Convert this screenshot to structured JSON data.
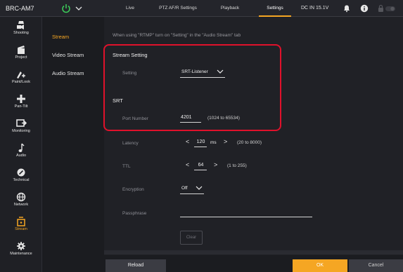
{
  "header": {
    "model": "BRC-AM7",
    "tabs": [
      {
        "label": "Live"
      },
      {
        "label": "PTZ AF/R Settings"
      },
      {
        "label": "Playback"
      },
      {
        "label": "Settings"
      }
    ],
    "active_tab": "Settings",
    "dc_status": "DC IN 15.1V"
  },
  "rail": {
    "items": [
      {
        "label": "Shooting",
        "icon": "camera-icon"
      },
      {
        "label": "Project",
        "icon": "clapper-icon"
      },
      {
        "label": "Paint/Look",
        "icon": "paint-icon"
      },
      {
        "label": "Pan-Tilt",
        "icon": "cross-icon"
      },
      {
        "label": "Monitoring",
        "icon": "monitor-icon"
      },
      {
        "label": "Audio",
        "icon": "note-icon"
      },
      {
        "label": "Technical",
        "icon": "wrench-icon"
      },
      {
        "label": "Network",
        "icon": "globe-icon"
      },
      {
        "label": "Stream",
        "icon": "stream-icon"
      },
      {
        "label": "Maintenance",
        "icon": "gear-icon"
      }
    ],
    "active": "Stream"
  },
  "submenu": {
    "items": [
      {
        "label": "Stream"
      },
      {
        "label": "Video Stream"
      },
      {
        "label": "Audio Stream"
      }
    ],
    "active": "Stream"
  },
  "content": {
    "notice": "When using \"RTMP\" turn on \"Setting\" in the \"Audio Stream\" tab",
    "stream_setting": {
      "section_title": "Stream Setting",
      "setting_label": "Setting",
      "setting_value": "SRT-Listener"
    },
    "srt": {
      "section_title": "SRT",
      "port_label": "Port Number",
      "port_value": "4201",
      "port_range": "(1024 to 65534)",
      "latency_label": "Latency",
      "latency_value": "120",
      "latency_unit": "ms",
      "latency_range": "(20 to 8000)",
      "ttl_label": "TTL",
      "ttl_value": "64",
      "ttl_range": "(1 to 255)",
      "encryption_label": "Encryption",
      "encryption_value": "Off",
      "passphrase_label": "Passphrase",
      "passphrase_value": "",
      "clear_label": "Clear"
    }
  },
  "footer": {
    "reload_label": "Reload",
    "ok_label": "OK",
    "cancel_label": "Cancel"
  },
  "colors": {
    "accent": "#f5a623",
    "highlight": "#e0112b",
    "background": "#1b1c20"
  }
}
